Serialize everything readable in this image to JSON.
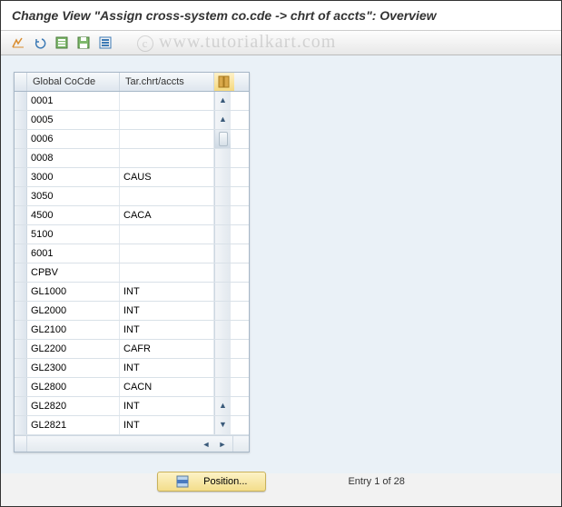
{
  "title": "Change View \"Assign cross-system co.cde -> chrt of accts\": Overview",
  "watermark": "www.tutorialkart.com",
  "toolbar": {
    "items": [
      {
        "name": "change-icon",
        "color": "#d98c2e"
      },
      {
        "name": "undo-icon",
        "color": "#3c7ab5"
      },
      {
        "name": "select-all-icon",
        "color": "#5a9e4a"
      },
      {
        "name": "save-icon",
        "color": "#5a9e4a"
      },
      {
        "name": "deselect-icon",
        "color": "#3c7ab5"
      }
    ]
  },
  "columns": {
    "col1": "Global CoCde",
    "col2": "Tar.chrt/accts"
  },
  "rows": [
    {
      "code": "0001",
      "chart": ""
    },
    {
      "code": "0005",
      "chart": ""
    },
    {
      "code": "0006",
      "chart": ""
    },
    {
      "code": "0008",
      "chart": ""
    },
    {
      "code": "3000",
      "chart": "CAUS"
    },
    {
      "code": "3050",
      "chart": ""
    },
    {
      "code": "4500",
      "chart": "CACA"
    },
    {
      "code": "5100",
      "chart": ""
    },
    {
      "code": "6001",
      "chart": ""
    },
    {
      "code": "CPBV",
      "chart": ""
    },
    {
      "code": "GL1000",
      "chart": "INT"
    },
    {
      "code": "GL2000",
      "chart": "INT"
    },
    {
      "code": "GL2100",
      "chart": "INT"
    },
    {
      "code": "GL2200",
      "chart": "CAFR"
    },
    {
      "code": "GL2300",
      "chart": "INT"
    },
    {
      "code": "GL2800",
      "chart": "CACN"
    },
    {
      "code": "GL2820",
      "chart": "INT"
    },
    {
      "code": "GL2821",
      "chart": "INT"
    }
  ],
  "footer": {
    "position_label": "Position...",
    "status": "Entry 1 of 28"
  }
}
